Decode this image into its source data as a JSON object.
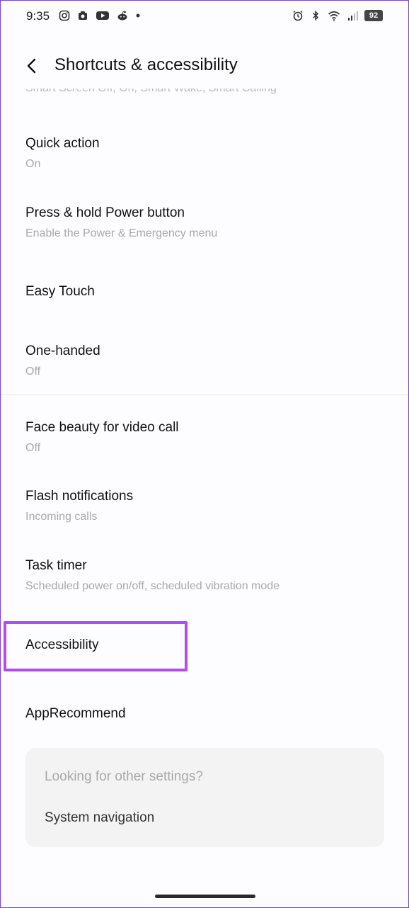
{
  "status_bar": {
    "time": "9:35",
    "battery": "92",
    "left_icons": [
      "instagram-icon",
      "camera-app-icon",
      "youtube-icon",
      "reddit-icon",
      "dot-icon"
    ],
    "right_icons": [
      "alarm-icon",
      "bluetooth-icon",
      "wifi-icon",
      "cellular-signal-icon",
      "battery-icon"
    ]
  },
  "header": {
    "title": "Shortcuts & accessibility",
    "back_icon": "chevron-left-icon"
  },
  "clipped_summary": "Smart Screen Off, On, Smart Wake, Smart Calling",
  "items": [
    {
      "title": "Quick action",
      "subtitle": "On"
    },
    {
      "title": "Press & hold Power button",
      "subtitle": "Enable the Power & Emergency menu"
    },
    {
      "title": "Easy Touch",
      "subtitle": ""
    },
    {
      "title": "One-handed",
      "subtitle": "Off"
    },
    {
      "title": "Face beauty for video call",
      "subtitle": "Off"
    },
    {
      "title": "Flash notifications",
      "subtitle": "Incoming calls"
    },
    {
      "title": "Task timer",
      "subtitle": "Scheduled power on/off, scheduled vibration mode"
    },
    {
      "title": "Accessibility",
      "subtitle": ""
    },
    {
      "title": "AppRecommend",
      "subtitle": ""
    }
  ],
  "suggestion_card": {
    "heading": "Looking for other settings?",
    "link": "System navigation"
  },
  "colors": {
    "highlight": "#b04cf0",
    "frame_border": "#7b3fe0",
    "subtitle": "#a9a9a9"
  }
}
